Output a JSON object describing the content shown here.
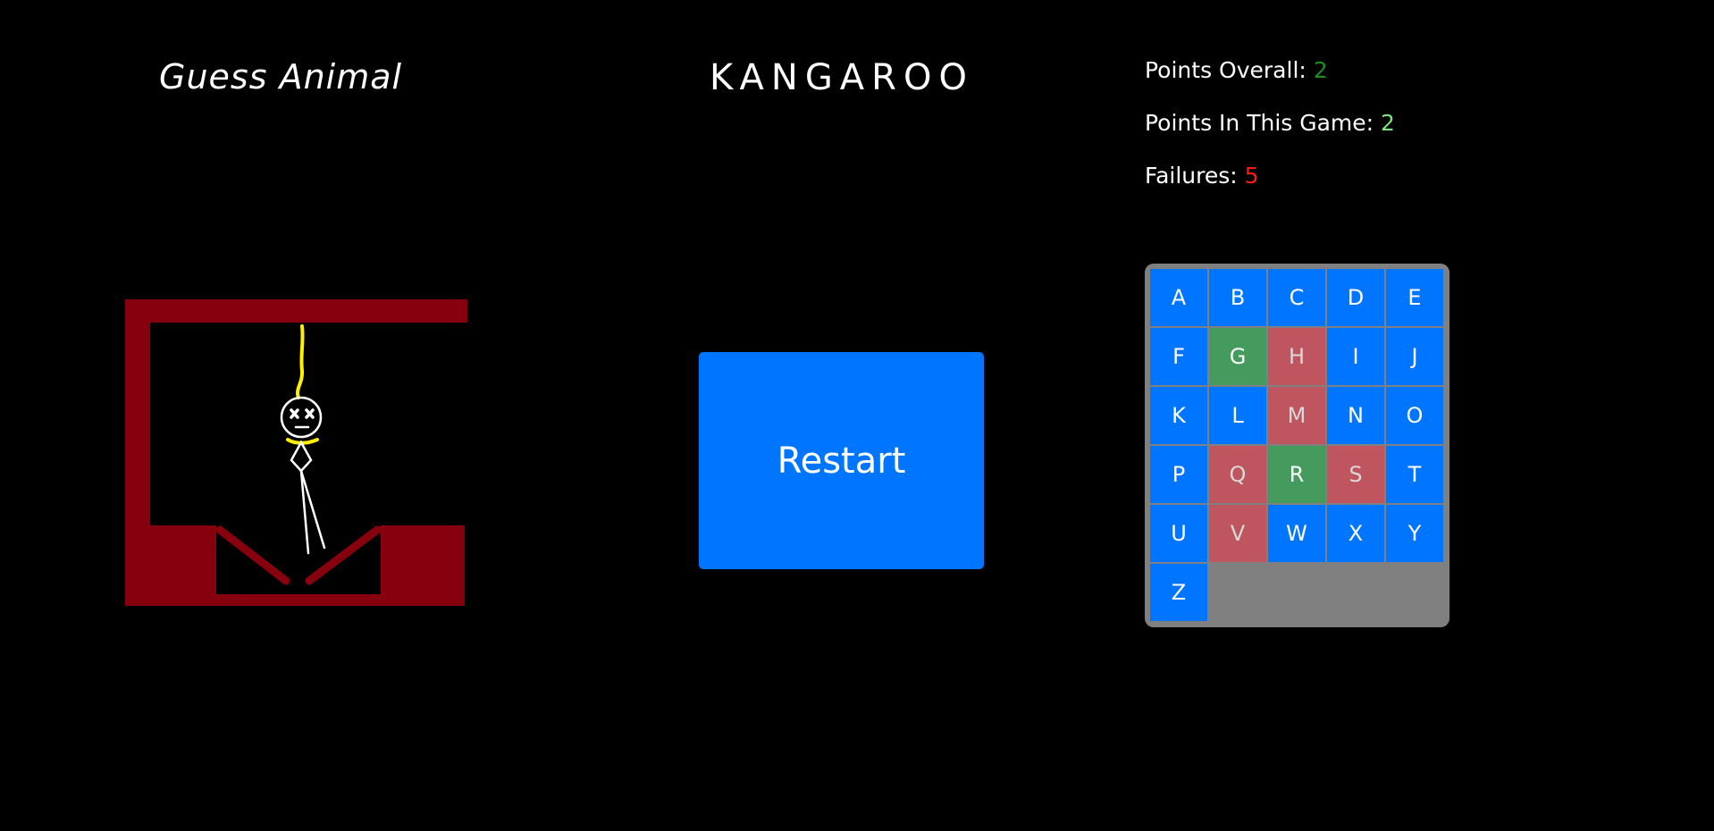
{
  "header": {
    "category": "Guess Animal",
    "word": "KANGAROO"
  },
  "stats": {
    "overall_label": "Points Overall:",
    "overall_value": "2",
    "overall_color": "#1a8f1a",
    "game_label": "Points In This Game:",
    "game_value": "2",
    "game_color": "#7ee07e",
    "failures_label": "Failures:",
    "failures_value": "5",
    "failures_color": "#ff1a1a"
  },
  "restart_label": "Restart",
  "colors": {
    "available": "#0075ff",
    "correct": "#459a5e",
    "wrong": "#bf555f",
    "wrong_text": "#d9d9d9",
    "gallows": "#87000d",
    "rope": "#ffef00",
    "figure": "#ffffff"
  },
  "keyboard": [
    {
      "letter": "A",
      "state": "available"
    },
    {
      "letter": "B",
      "state": "available"
    },
    {
      "letter": "C",
      "state": "available"
    },
    {
      "letter": "D",
      "state": "available"
    },
    {
      "letter": "E",
      "state": "available"
    },
    {
      "letter": "F",
      "state": "available"
    },
    {
      "letter": "G",
      "state": "correct"
    },
    {
      "letter": "H",
      "state": "wrong"
    },
    {
      "letter": "I",
      "state": "available"
    },
    {
      "letter": "J",
      "state": "available"
    },
    {
      "letter": "K",
      "state": "available"
    },
    {
      "letter": "L",
      "state": "available"
    },
    {
      "letter": "M",
      "state": "wrong"
    },
    {
      "letter": "N",
      "state": "available"
    },
    {
      "letter": "O",
      "state": "available"
    },
    {
      "letter": "P",
      "state": "available"
    },
    {
      "letter": "Q",
      "state": "wrong"
    },
    {
      "letter": "R",
      "state": "correct"
    },
    {
      "letter": "S",
      "state": "wrong"
    },
    {
      "letter": "T",
      "state": "available"
    },
    {
      "letter": "U",
      "state": "available"
    },
    {
      "letter": "V",
      "state": "wrong"
    },
    {
      "letter": "W",
      "state": "available"
    },
    {
      "letter": "X",
      "state": "available"
    },
    {
      "letter": "Y",
      "state": "available"
    },
    {
      "letter": "Z",
      "state": "available"
    }
  ]
}
